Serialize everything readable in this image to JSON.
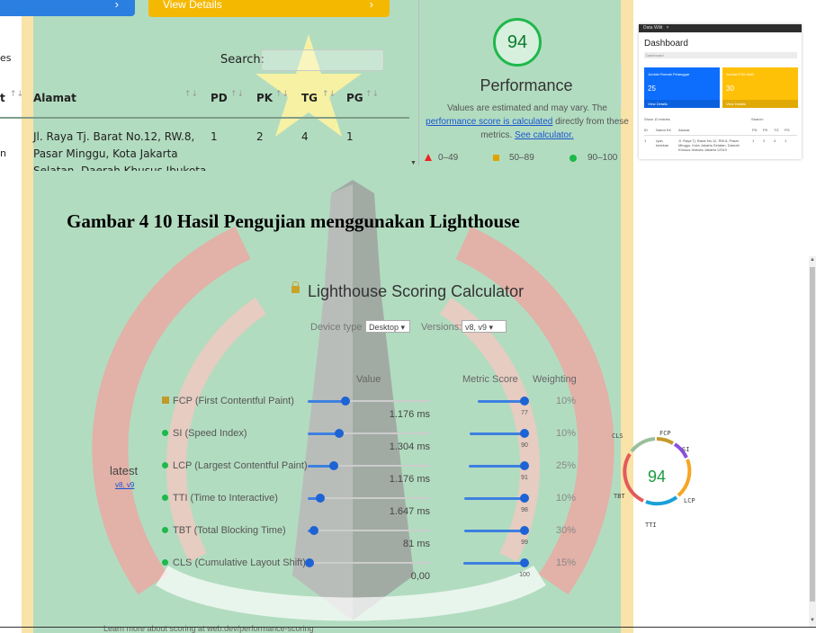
{
  "top_table": {
    "blue_button_chevron": "›",
    "view_details_label": "View Details",
    "view_details_chevron": "›",
    "entries_fragment": "es",
    "search_label": "Search:",
    "headers": {
      "col_fragment": "t",
      "alamat": "Alamat",
      "pd": "PD",
      "pk": "PK",
      "tg": "TG",
      "pg": "PG"
    },
    "sort_icon": "↑↓",
    "row": {
      "fragment": "n",
      "alamat_line1": "Jl. Raya Tj. Barat No.12, RW.8,",
      "alamat_line2": "Pasar Minggu, Kota Jakarta",
      "alamat_line3": "Selatan, Daerah Khusus Ibukota",
      "pd": "1",
      "pk": "2",
      "tg": "4",
      "pg": "1"
    }
  },
  "performance": {
    "score": "94",
    "title": "Performance",
    "note_line1": "Values are estimated and may vary. The",
    "note_link": "performance score is calculated",
    "note_line2_rest": " directly from these",
    "note_line3": "metrics. ",
    "calculator_link": "See calculator.",
    "legend": [
      "0–49",
      "50–89",
      "90–100"
    ],
    "colors": {
      "good": "#1eb84b",
      "average": "#e0a400",
      "poor": "#e22222"
    }
  },
  "mini_dashboard": {
    "tab": "Data Wilit",
    "title": "Dashboard",
    "breadcrumb": "Dashboard",
    "card1": {
      "title": "Jumlah Rumah Pelanggar",
      "count": "25",
      "footer": "View Details",
      "color": "#0d6efd"
    },
    "card2": {
      "title": "Jumlah PSK Aktif",
      "count": "30",
      "footer": "View Details",
      "color": "#ffc107"
    },
    "show_text": "Show 10 entries",
    "search_text": "Search:",
    "headers": [
      "ID",
      "Nama KK",
      "Alamat",
      "PD",
      "PK",
      "TG",
      "PG"
    ],
    "row": [
      "1",
      "ryan tubekan",
      "Jl. Raya Tj. Barat No.12, RW.8, Pasar Minggu, Kota Jakarta Selatan, Daerah Khusus Ibukota Jakarta 12510",
      "1",
      "2",
      "4",
      "1"
    ]
  },
  "caption": "Gambar 4 10 Hasil Pengujian menggunakan Lighthouse",
  "calculator": {
    "title": "Lighthouse Scoring Calculator",
    "device_label": "Device type",
    "device_value": "Desktop",
    "versions_label": "Versions:",
    "versions_value": "v8, v9",
    "col_value": "Value",
    "col_metric_score": "Metric Score",
    "col_weighting": "Weighting",
    "latest_label": "latest",
    "latest_versions": "v8, v9",
    "metrics": [
      {
        "name": "FCP (First Contentful Paint)",
        "value": "1.176 ms",
        "score": "77",
        "weight": "10%",
        "value_level": 0.31,
        "score_level": 0.77
      },
      {
        "name": "SI (Speed Index)",
        "value": "1.304 ms",
        "score": "90",
        "weight": "10%",
        "value_level": 0.26,
        "score_level": 0.9
      },
      {
        "name": "LCP (Largest Contentful Paint)",
        "value": "1.176 ms",
        "score": "91",
        "weight": "25%",
        "value_level": 0.21,
        "score_level": 0.91
      },
      {
        "name": "TTI (Time to Interactive)",
        "value": "1.647 ms",
        "score": "98",
        "weight": "10%",
        "value_level": 0.1,
        "score_level": 0.98
      },
      {
        "name": "TBT (Total Blocking Time)",
        "value": "81 ms",
        "score": "99",
        "weight": "30%",
        "value_level": 0.05,
        "score_level": 0.99
      },
      {
        "name": "CLS (Cumulative Layout Shift)",
        "value": "0,00",
        "score": "100",
        "weight": "15%",
        "value_level": 0.0,
        "score_level": 1.0
      }
    ],
    "gauge": {
      "score": "94",
      "labels": [
        "CLS",
        "FCP",
        "SI",
        "LCP",
        "TTI",
        "TBT"
      ]
    },
    "learn_more": "Learn more about scoring at web.dev/performance-scoring"
  }
}
